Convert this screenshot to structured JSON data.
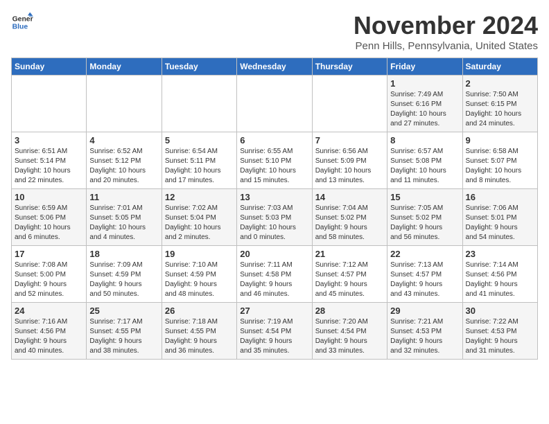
{
  "logo": {
    "line1": "General",
    "line2": "Blue"
  },
  "header": {
    "month": "November 2024",
    "location": "Penn Hills, Pennsylvania, United States"
  },
  "weekdays": [
    "Sunday",
    "Monday",
    "Tuesday",
    "Wednesday",
    "Thursday",
    "Friday",
    "Saturday"
  ],
  "weeks": [
    [
      {
        "day": "",
        "info": ""
      },
      {
        "day": "",
        "info": ""
      },
      {
        "day": "",
        "info": ""
      },
      {
        "day": "",
        "info": ""
      },
      {
        "day": "",
        "info": ""
      },
      {
        "day": "1",
        "info": "Sunrise: 7:49 AM\nSunset: 6:16 PM\nDaylight: 10 hours\nand 27 minutes."
      },
      {
        "day": "2",
        "info": "Sunrise: 7:50 AM\nSunset: 6:15 PM\nDaylight: 10 hours\nand 24 minutes."
      }
    ],
    [
      {
        "day": "3",
        "info": "Sunrise: 6:51 AM\nSunset: 5:14 PM\nDaylight: 10 hours\nand 22 minutes."
      },
      {
        "day": "4",
        "info": "Sunrise: 6:52 AM\nSunset: 5:12 PM\nDaylight: 10 hours\nand 20 minutes."
      },
      {
        "day": "5",
        "info": "Sunrise: 6:54 AM\nSunset: 5:11 PM\nDaylight: 10 hours\nand 17 minutes."
      },
      {
        "day": "6",
        "info": "Sunrise: 6:55 AM\nSunset: 5:10 PM\nDaylight: 10 hours\nand 15 minutes."
      },
      {
        "day": "7",
        "info": "Sunrise: 6:56 AM\nSunset: 5:09 PM\nDaylight: 10 hours\nand 13 minutes."
      },
      {
        "day": "8",
        "info": "Sunrise: 6:57 AM\nSunset: 5:08 PM\nDaylight: 10 hours\nand 11 minutes."
      },
      {
        "day": "9",
        "info": "Sunrise: 6:58 AM\nSunset: 5:07 PM\nDaylight: 10 hours\nand 8 minutes."
      }
    ],
    [
      {
        "day": "10",
        "info": "Sunrise: 6:59 AM\nSunset: 5:06 PM\nDaylight: 10 hours\nand 6 minutes."
      },
      {
        "day": "11",
        "info": "Sunrise: 7:01 AM\nSunset: 5:05 PM\nDaylight: 10 hours\nand 4 minutes."
      },
      {
        "day": "12",
        "info": "Sunrise: 7:02 AM\nSunset: 5:04 PM\nDaylight: 10 hours\nand 2 minutes."
      },
      {
        "day": "13",
        "info": "Sunrise: 7:03 AM\nSunset: 5:03 PM\nDaylight: 10 hours\nand 0 minutes."
      },
      {
        "day": "14",
        "info": "Sunrise: 7:04 AM\nSunset: 5:02 PM\nDaylight: 9 hours\nand 58 minutes."
      },
      {
        "day": "15",
        "info": "Sunrise: 7:05 AM\nSunset: 5:02 PM\nDaylight: 9 hours\nand 56 minutes."
      },
      {
        "day": "16",
        "info": "Sunrise: 7:06 AM\nSunset: 5:01 PM\nDaylight: 9 hours\nand 54 minutes."
      }
    ],
    [
      {
        "day": "17",
        "info": "Sunrise: 7:08 AM\nSunset: 5:00 PM\nDaylight: 9 hours\nand 52 minutes."
      },
      {
        "day": "18",
        "info": "Sunrise: 7:09 AM\nSunset: 4:59 PM\nDaylight: 9 hours\nand 50 minutes."
      },
      {
        "day": "19",
        "info": "Sunrise: 7:10 AM\nSunset: 4:59 PM\nDaylight: 9 hours\nand 48 minutes."
      },
      {
        "day": "20",
        "info": "Sunrise: 7:11 AM\nSunset: 4:58 PM\nDaylight: 9 hours\nand 46 minutes."
      },
      {
        "day": "21",
        "info": "Sunrise: 7:12 AM\nSunset: 4:57 PM\nDaylight: 9 hours\nand 45 minutes."
      },
      {
        "day": "22",
        "info": "Sunrise: 7:13 AM\nSunset: 4:57 PM\nDaylight: 9 hours\nand 43 minutes."
      },
      {
        "day": "23",
        "info": "Sunrise: 7:14 AM\nSunset: 4:56 PM\nDaylight: 9 hours\nand 41 minutes."
      }
    ],
    [
      {
        "day": "24",
        "info": "Sunrise: 7:16 AM\nSunset: 4:56 PM\nDaylight: 9 hours\nand 40 minutes."
      },
      {
        "day": "25",
        "info": "Sunrise: 7:17 AM\nSunset: 4:55 PM\nDaylight: 9 hours\nand 38 minutes."
      },
      {
        "day": "26",
        "info": "Sunrise: 7:18 AM\nSunset: 4:55 PM\nDaylight: 9 hours\nand 36 minutes."
      },
      {
        "day": "27",
        "info": "Sunrise: 7:19 AM\nSunset: 4:54 PM\nDaylight: 9 hours\nand 35 minutes."
      },
      {
        "day": "28",
        "info": "Sunrise: 7:20 AM\nSunset: 4:54 PM\nDaylight: 9 hours\nand 33 minutes."
      },
      {
        "day": "29",
        "info": "Sunrise: 7:21 AM\nSunset: 4:53 PM\nDaylight: 9 hours\nand 32 minutes."
      },
      {
        "day": "30",
        "info": "Sunrise: 7:22 AM\nSunset: 4:53 PM\nDaylight: 9 hours\nand 31 minutes."
      }
    ]
  ]
}
